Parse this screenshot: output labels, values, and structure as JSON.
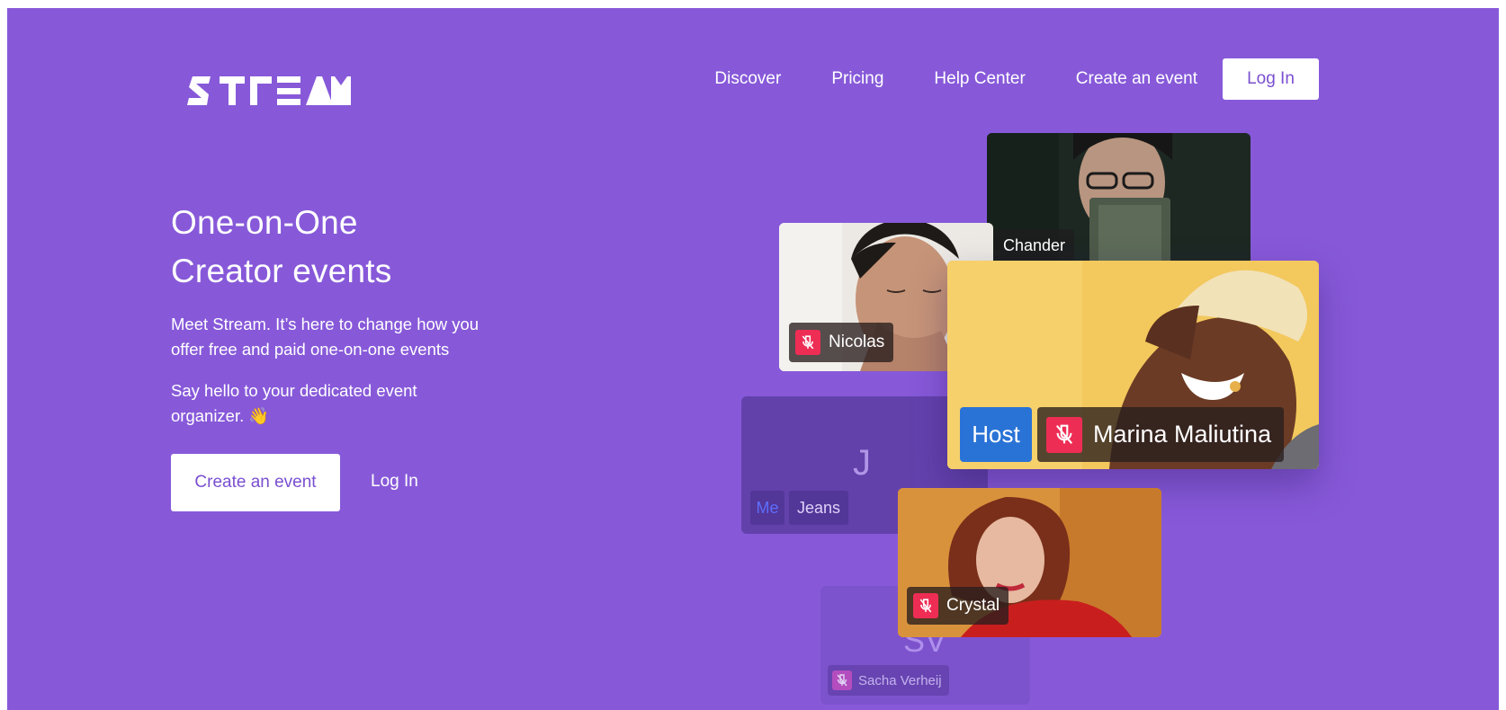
{
  "header": {
    "logo_text": "STREAM",
    "nav": [
      {
        "label": "Discover"
      },
      {
        "label": "Pricing"
      },
      {
        "label": "Help Center"
      },
      {
        "label": "Create an event"
      }
    ],
    "login_label": "Log In"
  },
  "hero": {
    "title_line1": "One-on-One",
    "title_line2": "Creator events",
    "description": "Meet Stream. It’s here to change how you offer free and paid one-on-one events",
    "greeting": "Say hello to your dedicated event organizer. 👋",
    "cta_create": "Create an event",
    "cta_login": "Log In"
  },
  "tiles": {
    "chander": {
      "name": "Chander"
    },
    "nicolas": {
      "name": "Nicolas"
    },
    "marina": {
      "name": "Marina Maliutina",
      "role": "Host"
    },
    "jeans": {
      "initial": "J",
      "me_label": "Me",
      "name": "Jeans"
    },
    "crystal": {
      "name": "Crystal"
    },
    "sacha": {
      "initial": "SV",
      "name": "Sacha Verheij"
    }
  },
  "colors": {
    "background": "#8759d9",
    "accent_text": "#7a4fd0",
    "mute": "#ee2d55",
    "host": "#2a73d6"
  },
  "icons": {
    "mute": "microphone-muted-icon",
    "wave": "waving-hand-emoji"
  }
}
